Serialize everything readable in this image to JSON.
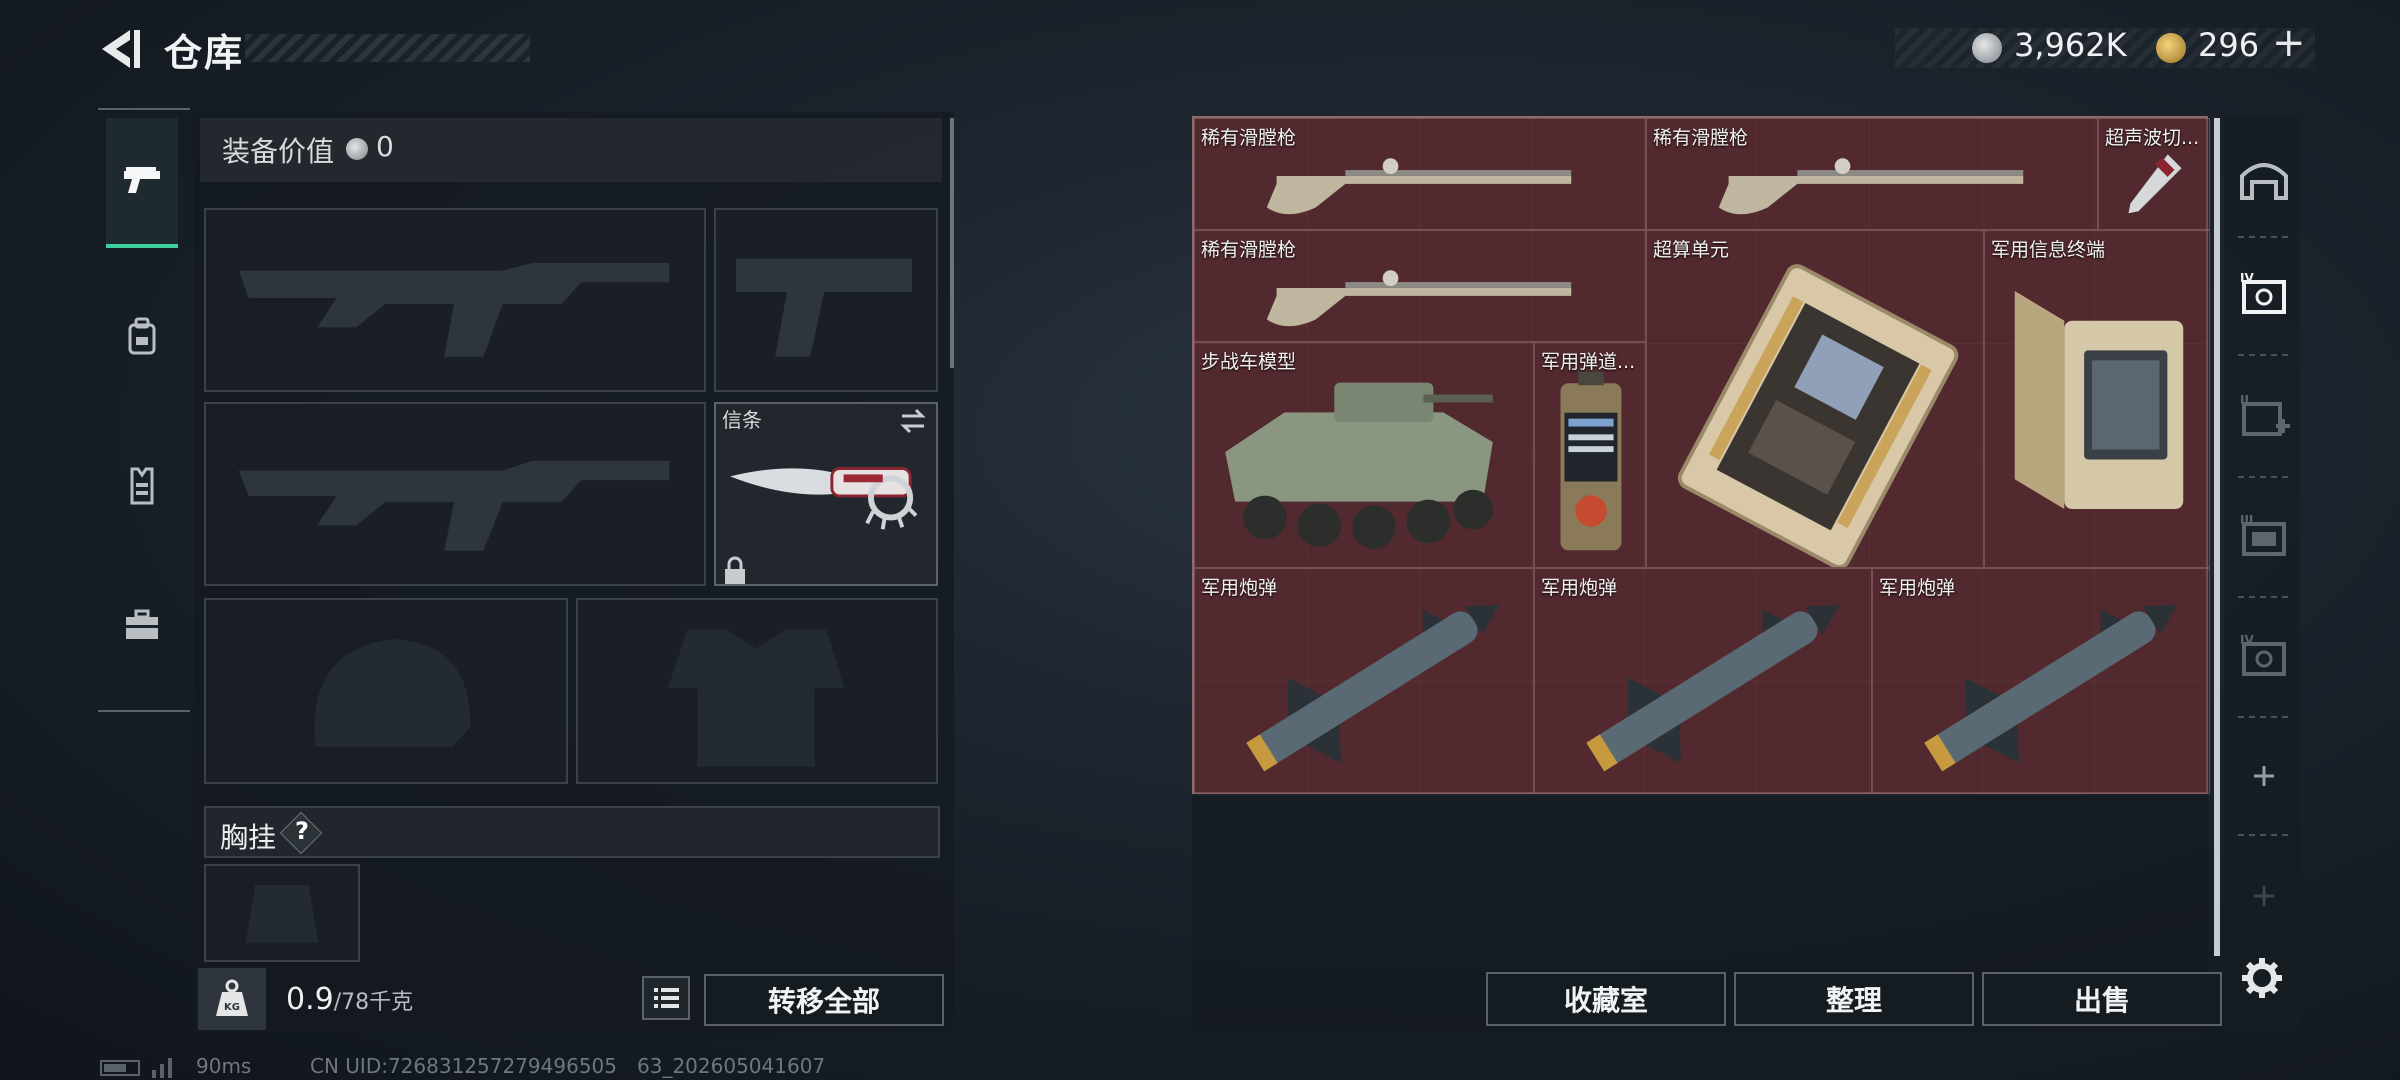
{
  "header": {
    "title": "仓库",
    "currency": {
      "coins": "3,962K",
      "tokens": "296",
      "add_label": "+"
    }
  },
  "equipment": {
    "value_label": "装备价值",
    "value": "0",
    "knife_label": "信条",
    "chest_rig_label": "胸挂",
    "chest_rig_help": "?"
  },
  "capacity": {
    "current": "0.9",
    "max": "/78千克",
    "transfer_all_label": "转移全部"
  },
  "storage": {
    "items": [
      {
        "name": "稀有滑膛枪",
        "icon": "flintlock-musket"
      },
      {
        "name": "稀有滑膛枪",
        "icon": "flintlock-musket"
      },
      {
        "name": "超声波切...",
        "icon": "ultrasonic-cutter"
      },
      {
        "name": "稀有滑膛枪",
        "icon": "flintlock-musket"
      },
      {
        "name": "超算单元",
        "icon": "supercomputing-unit"
      },
      {
        "name": "军用信息终端",
        "icon": "military-terminal"
      },
      {
        "name": "步战车模型",
        "icon": "ifv-model"
      },
      {
        "name": "军用弹道...",
        "icon": "ballistic-computer"
      },
      {
        "name": "军用炮弹",
        "icon": "artillery-shell"
      },
      {
        "name": "军用炮弹",
        "icon": "artillery-shell"
      },
      {
        "name": "军用炮弹",
        "icon": "artillery-shell"
      }
    ]
  },
  "actions": {
    "vault": "收藏室",
    "tidy": "整理",
    "sell": "出售"
  },
  "footer": {
    "ping": "90ms",
    "uid": "CN UID:726831257279496505 63_202605041607"
  },
  "colors": {
    "accent": "#3fd0a0",
    "storage_bg": "#4c2a2f",
    "gold": "#d4a84a"
  }
}
